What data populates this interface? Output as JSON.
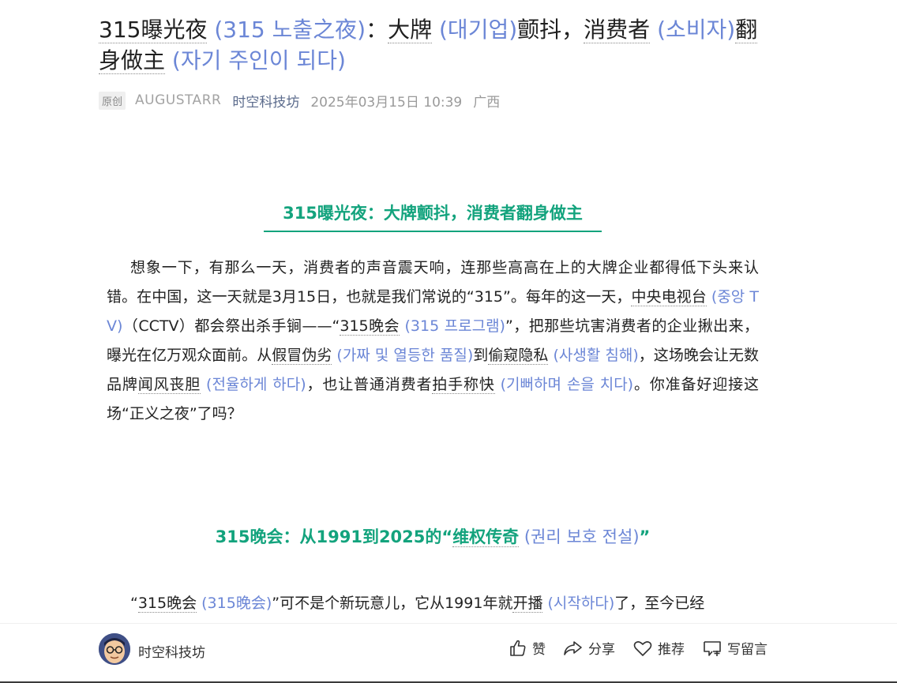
{
  "article": {
    "title": {
      "seg1": "315曝光夜",
      "tr1": " (315 노출之夜)",
      "colon": "：",
      "seg2": "大牌",
      "tr2": " (대기업)",
      "seg3": "颤抖",
      "comma": "，",
      "seg4": "消费者",
      "tr3": " (소비자)",
      "seg5": "翻身做主",
      "tr4": " (자기 주인이 되다)"
    },
    "meta": {
      "badge": "原创",
      "author": "AUGUSTARR",
      "account": "时空科技坊",
      "datetime": "2025年03月15日 10:39",
      "location": "广西"
    }
  },
  "section1": {
    "heading": "315曝光夜：大牌颤抖，消费者翻身做主"
  },
  "para1": {
    "t1": "想象一下，有那么一天，消费者的声音震天响，连那些高高在上的大牌企业都得低下头来认错。在中国，这一天就是3月15日，也就是我们常说的“315”。每年的这一天，",
    "k1": "中央电视台",
    "tr1": " (중앙 TV)",
    "t2": "（CCTV）都会祭出杀手锏——“",
    "k2": "315晚会",
    "tr2": " (315 프로그램)",
    "t3": "”，把那些坑害消费者的企业揪出来，曝光在亿万观众面前。从",
    "k3": "假冒伪劣",
    "tr3": " (가짜 및 열등한 품질)",
    "t4": "到",
    "k4": "偷窥隐私",
    "tr4": " (사생활 침해)",
    "t5": "，这场晚会让无数品牌",
    "k5": "闻风丧胆",
    "tr5": " (전율하게 하다)",
    "t6": "，也让普通消费者",
    "k6": "拍手称快",
    "tr6": " (기뻐하며 손을 치다)",
    "t7": "。你准备好迎接这场“正义之夜”了吗？"
  },
  "section2": {
    "h1": "315晚会：从1991到2025的“",
    "k1": "维权传奇",
    "tr1": " (권리 보호 전설)",
    "h2": "”"
  },
  "para2": {
    "t1": "“",
    "k1": "315晚会",
    "tr1": " (315晚会)",
    "t2": "”可不是个新玩意儿，它从1991年就",
    "k2": "开播",
    "tr2": " (시작하다)",
    "t3": "了，至今已经"
  },
  "bottombar": {
    "account_name": "时空科技坊",
    "like_label": "赞",
    "share_label": "分享",
    "recommend_label": "推荐",
    "comment_label": "写留言",
    "icons": [
      "thumbs-up-icon",
      "share-icon",
      "heart-icon",
      "comment-icon"
    ]
  },
  "colors": {
    "accent_green": "#13a37d",
    "translation_blue": "#6b86d6"
  }
}
